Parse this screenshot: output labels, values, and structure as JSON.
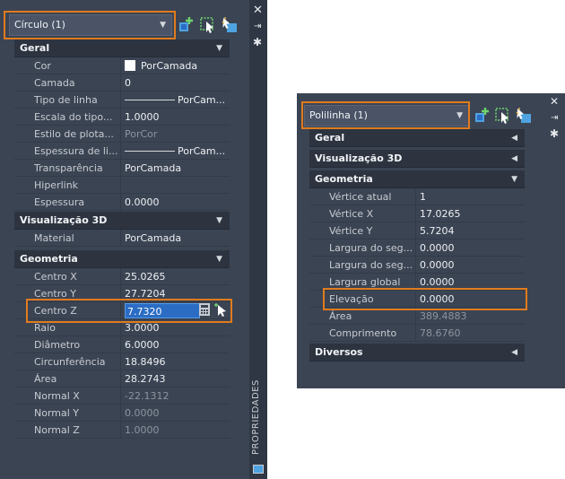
{
  "left": {
    "selector": "Círculo (1)",
    "sections": [
      {
        "title": "Geral",
        "rows": [
          {
            "name": "Cor",
            "value": "PorCamada",
            "kind": "swatch"
          },
          {
            "name": "Camada",
            "value": "0"
          },
          {
            "name": "Tipo de linha",
            "value": "PorCam...",
            "kind": "line"
          },
          {
            "name": "Escala do tipo...",
            "value": "1.0000"
          },
          {
            "name": "Estilo de plota...",
            "value": "PorCor",
            "dim": true
          },
          {
            "name": "Espessura de li...",
            "value": "PorCam...",
            "kind": "line"
          },
          {
            "name": "Transparência",
            "value": "PorCamada"
          },
          {
            "name": "Hiperlink",
            "value": ""
          },
          {
            "name": "Espessura",
            "value": "0.0000"
          }
        ]
      },
      {
        "title": "Visualização 3D",
        "rows": [
          {
            "name": "Material",
            "value": "PorCamada"
          }
        ]
      },
      {
        "title": "Geometria",
        "rows": [
          {
            "name": "Centro X",
            "value": "25.0265"
          },
          {
            "name": "Centro Y",
            "value": "27.7204"
          },
          {
            "name": "Centro Z",
            "value": "7.7320",
            "kind": "edit"
          },
          {
            "name": "Raio",
            "value": "3.0000"
          },
          {
            "name": "Diâmetro",
            "value": "6.0000"
          },
          {
            "name": "Circunferência",
            "value": "18.8496"
          },
          {
            "name": "Área",
            "value": "28.2743"
          },
          {
            "name": "Normal X",
            "value": "-22.1312",
            "dim": true
          },
          {
            "name": "Normal Y",
            "value": "0.0000",
            "dim": true
          },
          {
            "name": "Normal Z",
            "value": "1.0000",
            "dim": true
          }
        ]
      }
    ],
    "side_label": "PROPRIEDADES"
  },
  "right": {
    "selector": "Polilinha (1)",
    "sections": [
      {
        "title": "Geral",
        "collapsed": true
      },
      {
        "title": "Visualização 3D",
        "collapsed": true
      },
      {
        "title": "Geometria",
        "rows": [
          {
            "name": "Vértice atual",
            "value": "1"
          },
          {
            "name": "Vértice X",
            "value": "17.0265"
          },
          {
            "name": "Vértice Y",
            "value": "5.7204"
          },
          {
            "name": "Largura do seg...",
            "value": "0.0000"
          },
          {
            "name": "Largura do seg...",
            "value": "0.0000"
          },
          {
            "name": "Largura global",
            "value": "0.0000"
          },
          {
            "name": "Elevação",
            "value": "0.0000"
          },
          {
            "name": "Área",
            "value": "389.4883",
            "dim": true
          },
          {
            "name": "Comprimento",
            "value": "78.6760",
            "dim": true
          }
        ]
      },
      {
        "title": "Diversos",
        "collapsed": true
      }
    ]
  }
}
